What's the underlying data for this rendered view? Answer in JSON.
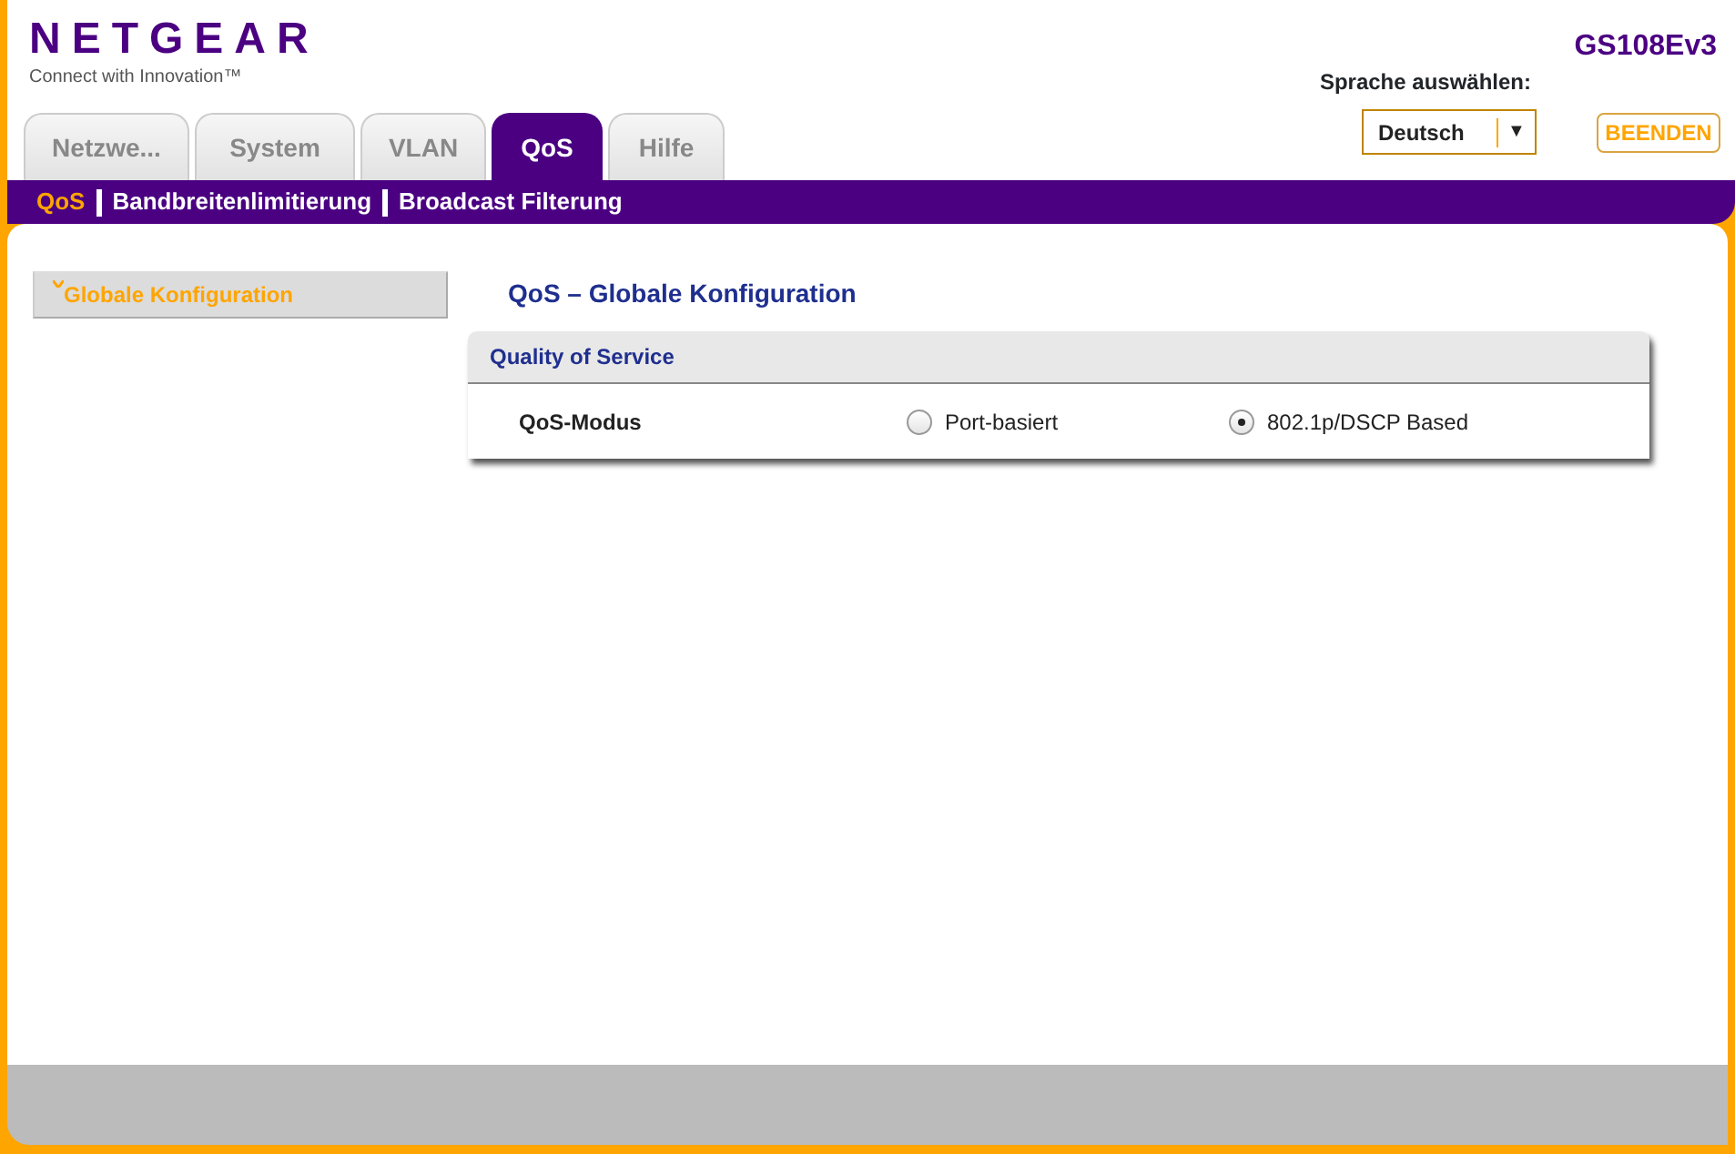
{
  "header": {
    "logo": "NETGEAR",
    "tagline": "Connect with Innovation™",
    "model": "GS108Ev3",
    "language_label": "Sprache auswählen:",
    "language_select": {
      "value": "Deutsch",
      "arrow": "▼"
    },
    "logout_button": "BEENDEN"
  },
  "tabs": [
    {
      "label": "Netzwe...",
      "selected": false
    },
    {
      "label": "System",
      "selected": false
    },
    {
      "label": "VLAN",
      "selected": false
    },
    {
      "label": "QoS",
      "selected": true
    },
    {
      "label": "Hilfe",
      "selected": false
    }
  ],
  "subnav": [
    {
      "label": "QoS",
      "selected": true
    },
    {
      "label": "Bandbreitenlimitierung",
      "selected": false
    },
    {
      "label": "Broadcast Filterung",
      "selected": false
    }
  ],
  "sidebar": {
    "items": [
      {
        "label": "Globale Konfiguration",
        "selected": true
      }
    ]
  },
  "page_title": "QoS – Globale Konfiguration",
  "panel": {
    "title": "Quality of Service",
    "field_label": "QoS-Modus",
    "options": [
      {
        "label": "Port-basiert",
        "selected": false
      },
      {
        "label": "802.1p/DSCP Based",
        "selected": true
      }
    ]
  }
}
